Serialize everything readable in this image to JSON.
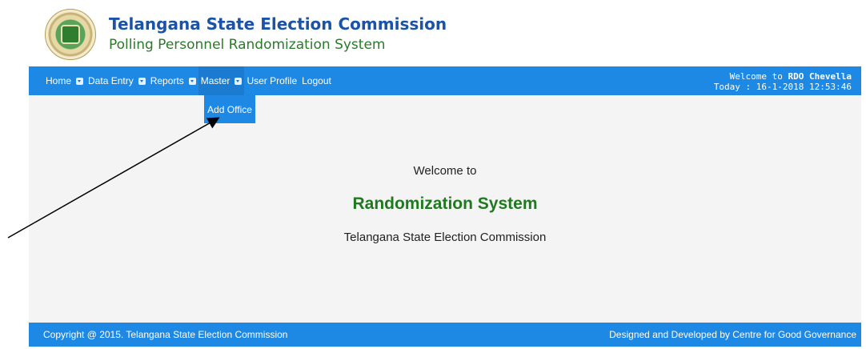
{
  "header": {
    "title": "Telangana State Election Commission",
    "subtitle": "Polling Personnel Randomization System"
  },
  "nav": {
    "items": [
      {
        "label": "Home",
        "dropdown": true
      },
      {
        "label": "Data Entry",
        "dropdown": true
      },
      {
        "label": "Reports",
        "dropdown": true
      },
      {
        "label": "Master",
        "dropdown": true
      },
      {
        "label": "User Profile",
        "dropdown": false
      },
      {
        "label": "Logout",
        "dropdown": false
      }
    ],
    "welcome_prefix": "Welcome to ",
    "welcome_user": "RDO Chevella",
    "today": "Today : 16-1-2018 12:53:46"
  },
  "dropdown": {
    "items": [
      {
        "label": "Add Office"
      }
    ]
  },
  "main": {
    "welcome": "Welcome to",
    "system": "Randomization System",
    "org": "Telangana State Election Commission"
  },
  "footer": {
    "copyright": "Copyright @ 2015. Telangana State Election Commission",
    "credit": "Designed and Developed by Centre for Good Governance"
  },
  "colors": {
    "nav_blue": "#1e88e5",
    "title_blue": "#1b53a6",
    "green": "#1f7a1f"
  }
}
